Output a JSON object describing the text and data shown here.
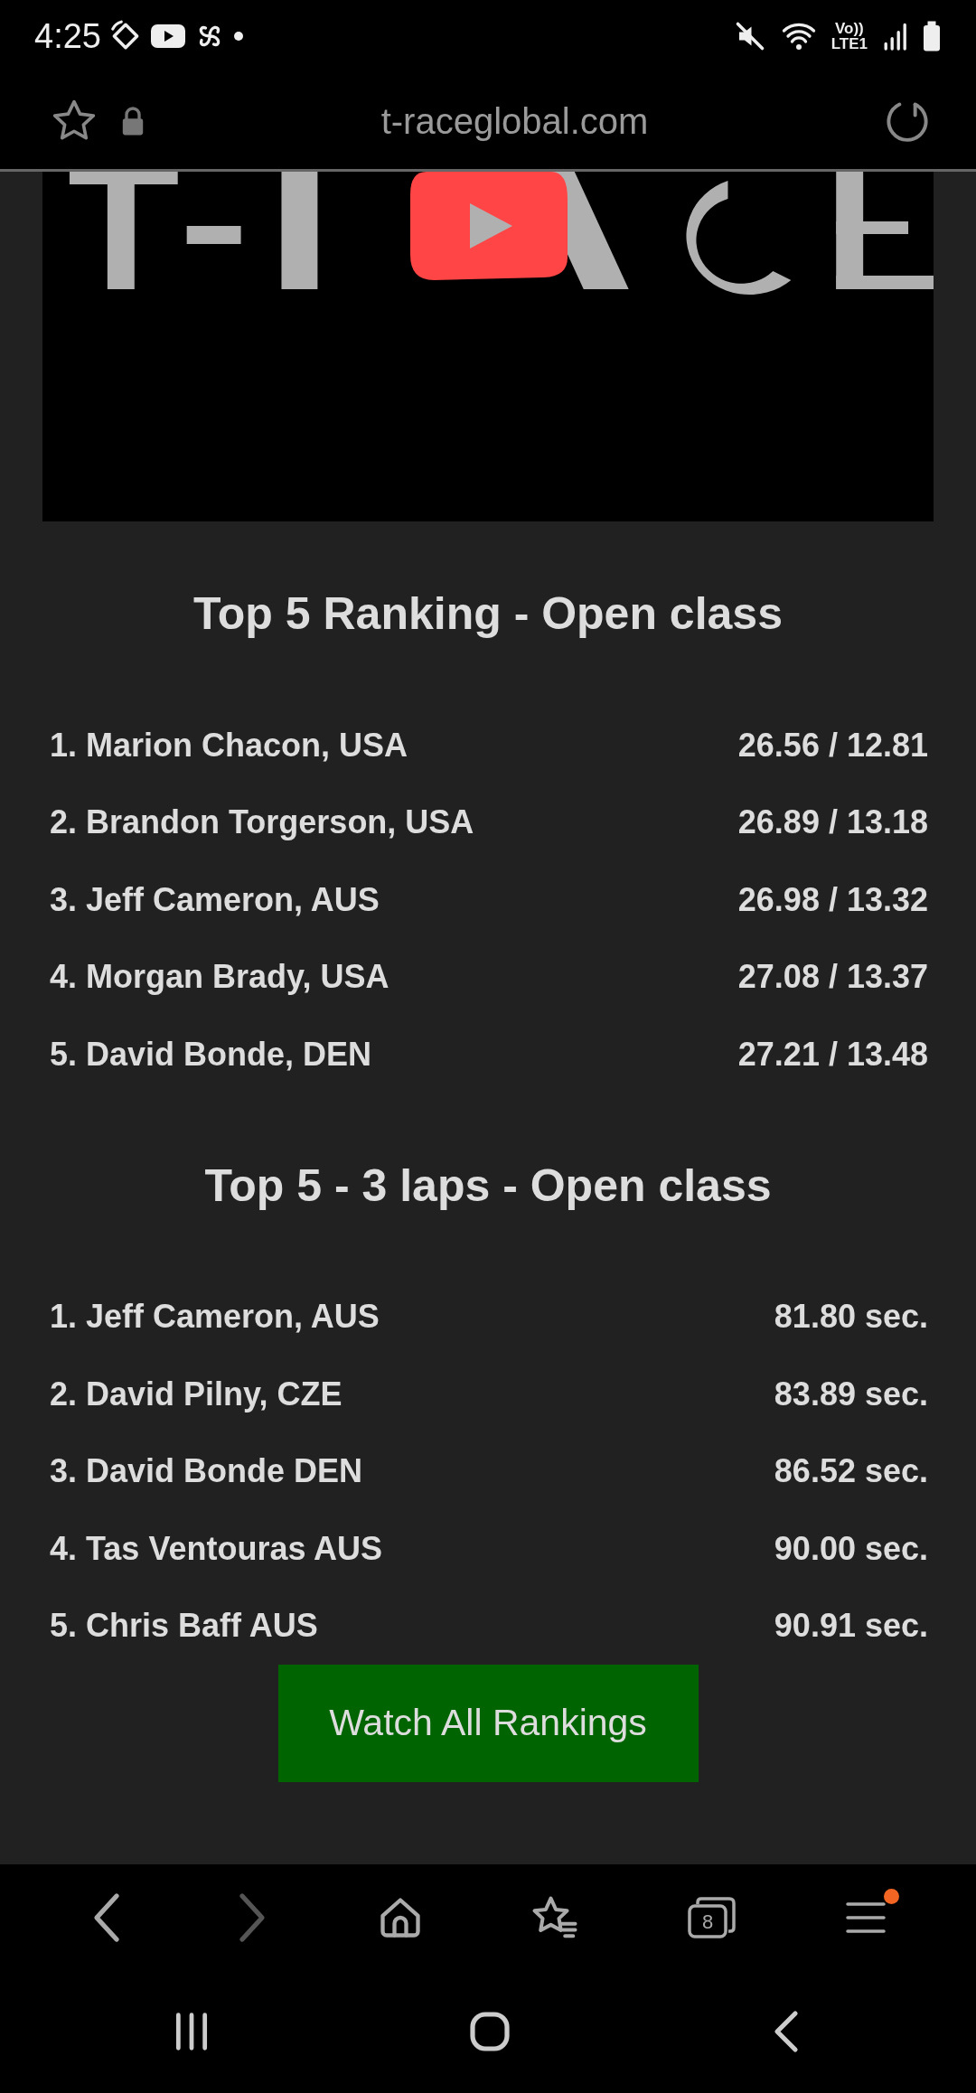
{
  "status_bar": {
    "time": "4:25",
    "network_top": "Vo))",
    "network_bottom": "LTE1"
  },
  "address_bar": {
    "url": "t-raceglobal.com"
  },
  "sections": [
    {
      "title": "Top 5 Ranking - Open class",
      "rows": [
        {
          "name": "1. Marion Chacon, USA",
          "result": "26.56 / 12.81"
        },
        {
          "name": "2. Brandon Torgerson, USA",
          "result": "26.89 / 13.18"
        },
        {
          "name": "3. Jeff Cameron, AUS",
          "result": "26.98 / 13.32"
        },
        {
          "name": "4. Morgan Brady, USA",
          "result": "27.08 / 13.37"
        },
        {
          "name": "5. David Bonde, DEN",
          "result": "27.21 / 13.48"
        }
      ]
    },
    {
      "title": "Top 5 - 3 laps - Open class",
      "rows": [
        {
          "name": "1. Jeff Cameron, AUS",
          "result": "81.80 sec."
        },
        {
          "name": "2. David Pilny, CZE",
          "result": "83.89 sec."
        },
        {
          "name": "3. David Bonde DEN",
          "result": "86.52 sec."
        },
        {
          "name": "4. Tas Ventouras AUS",
          "result": "90.00 sec."
        },
        {
          "name": "5. Chris Baff AUS",
          "result": "90.91 sec."
        }
      ]
    }
  ],
  "button": {
    "label": "Watch All Rankings"
  },
  "toolbar": {
    "forward_disabled": true,
    "tab_count": "8",
    "menu_badge": true
  }
}
